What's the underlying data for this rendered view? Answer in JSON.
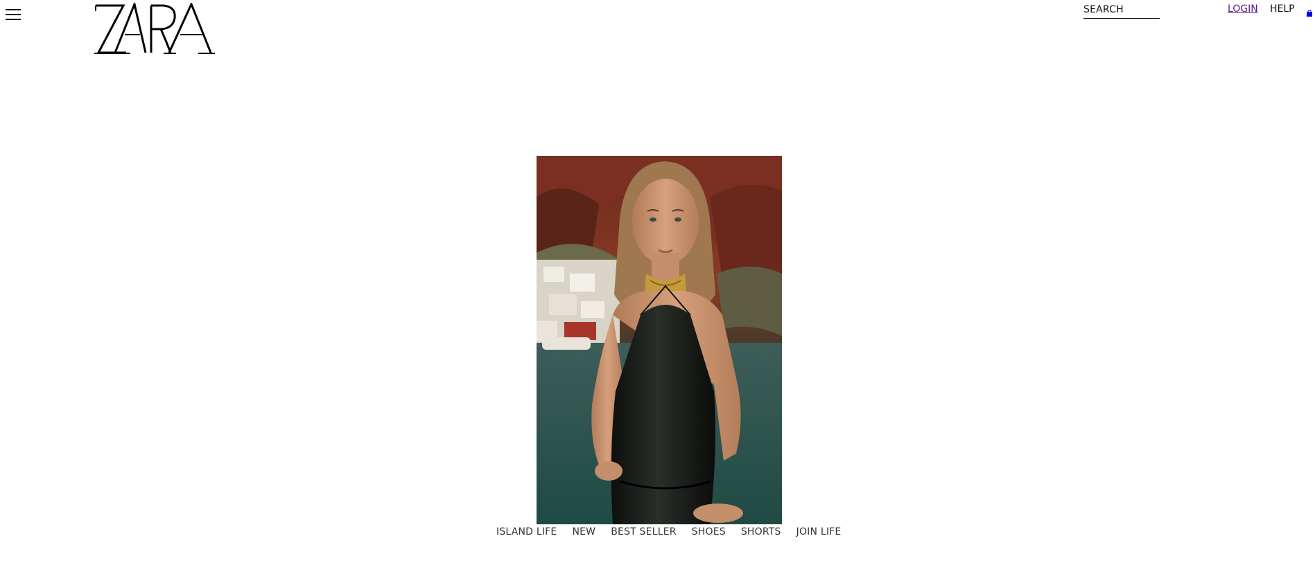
{
  "brand": {
    "name": "ZARA"
  },
  "header": {
    "search_label": "SEARCH",
    "login_label": "LOGIN",
    "help_label": "HELP",
    "menu_icon": "hamburger-menu-icon",
    "bag_icon": "shopping-bag-icon"
  },
  "categories": [
    {
      "label": "ISLAND LIFE"
    },
    {
      "label": "NEW"
    },
    {
      "label": "BEST SELLER"
    },
    {
      "label": "SHOES"
    },
    {
      "label": "SHORTS"
    },
    {
      "label": "JOIN LIFE"
    }
  ],
  "colors": {
    "link_visited": "#551a8b",
    "bag_accent": "#0000ee",
    "text": "#111111"
  }
}
